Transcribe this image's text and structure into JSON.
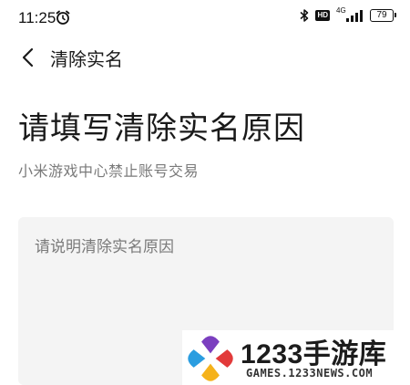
{
  "status_bar": {
    "time": "11:25",
    "hd_badge": "HD",
    "network": "4G",
    "battery": "79",
    "icons": [
      "alarm-icon",
      "bluetooth-icon",
      "signal-icon",
      "battery-icon"
    ]
  },
  "nav": {
    "back_icon": "chevron-left-icon",
    "title": "清除实名"
  },
  "page": {
    "title": "请填写清除实名原因",
    "subtitle": "小米游戏中心禁止账号交易"
  },
  "form": {
    "reason_value": "",
    "reason_placeholder": "请说明清除实名原因"
  },
  "watermark": {
    "brand": "1233手游库",
    "url": "GAMES.1233NEWS.COM",
    "colors": [
      "#7b3fbf",
      "#e23a3a",
      "#f5b21b",
      "#2a9de0"
    ]
  }
}
